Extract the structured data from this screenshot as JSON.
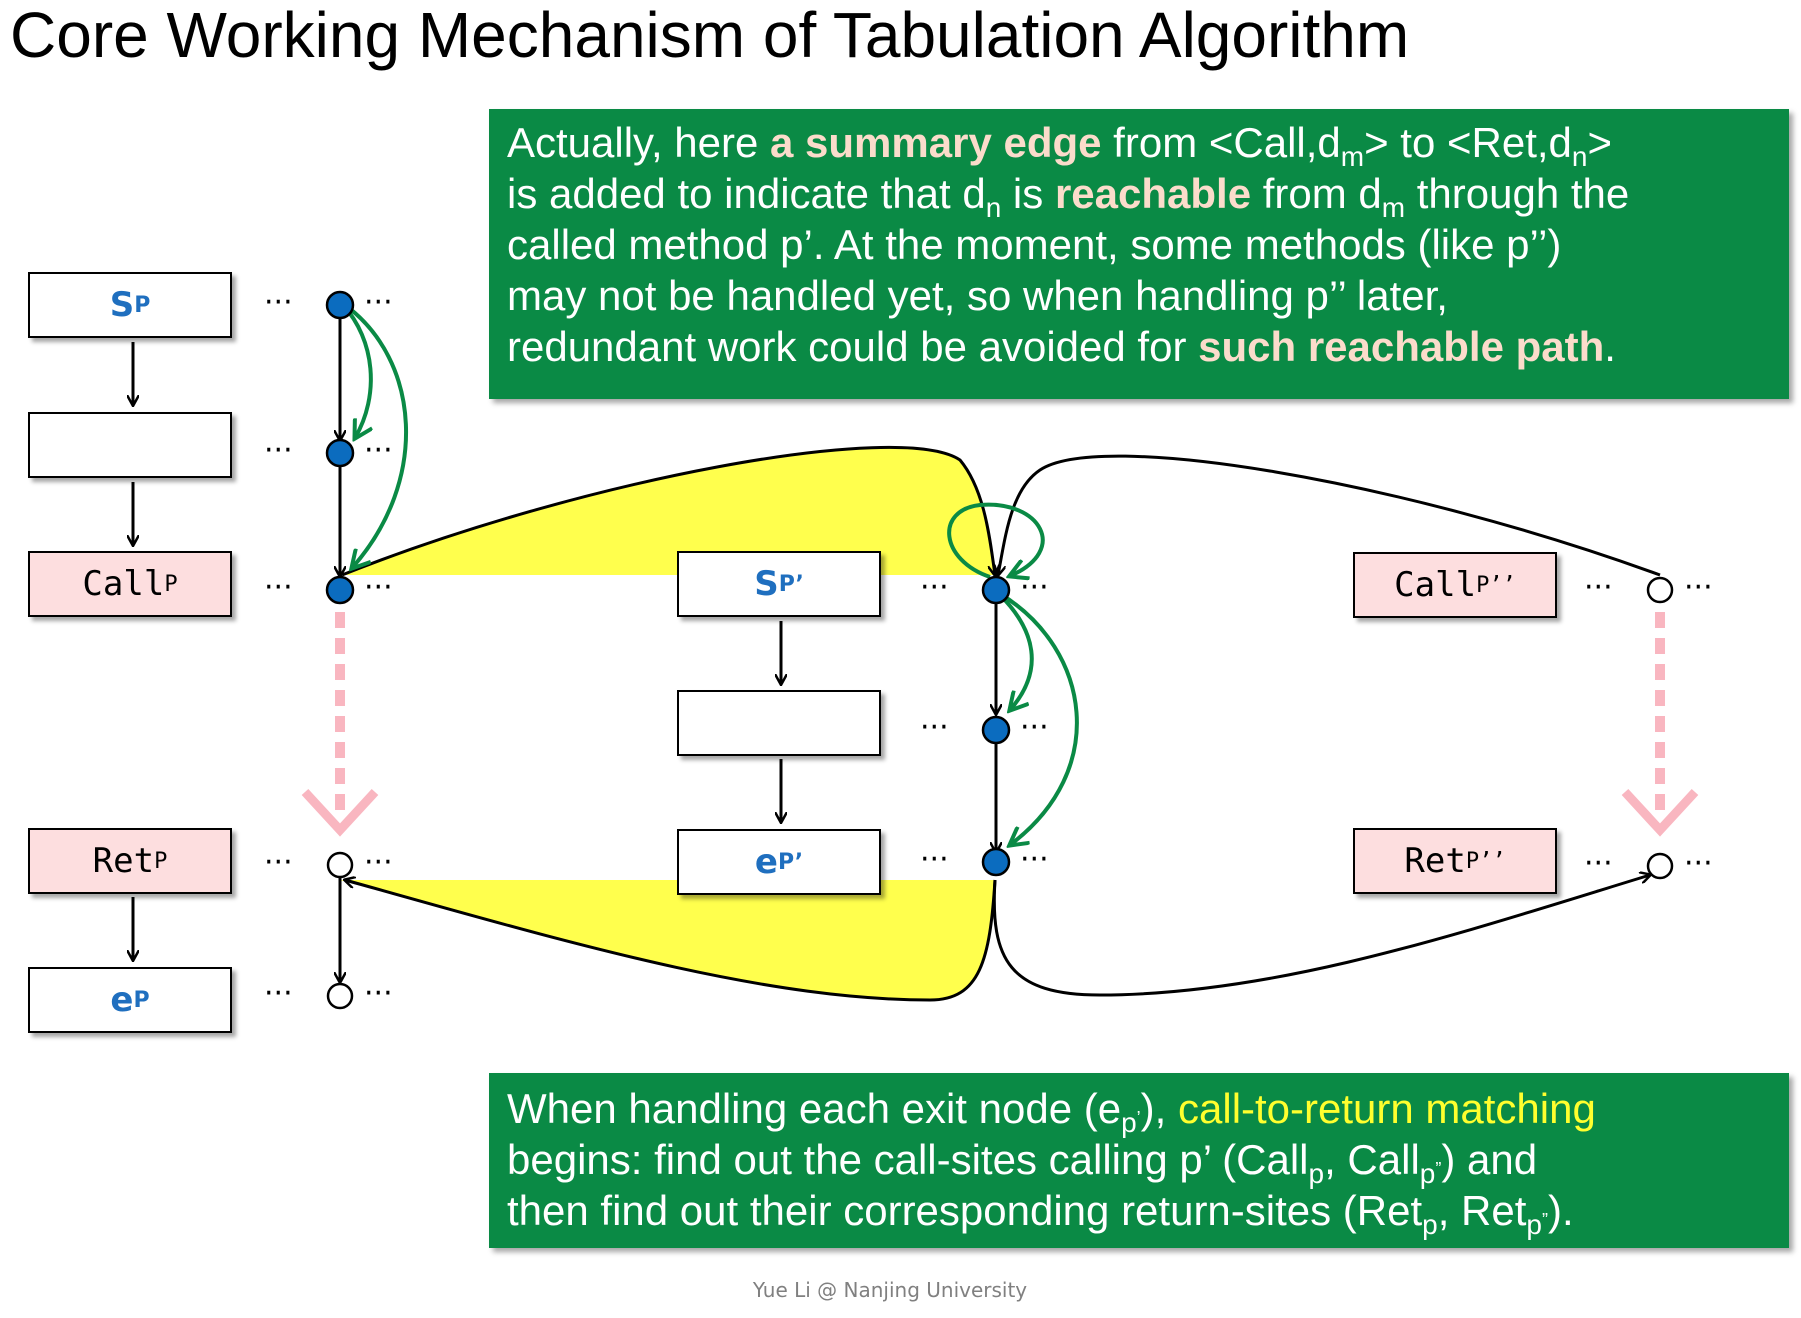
{
  "title": "Core Working Mechanism of Tabulation Algorithm",
  "footer": "Yue Li @ Nanjing University",
  "nodes": {
    "sp": {
      "main": "S",
      "sub": "P"
    },
    "call_p": {
      "main": "Call",
      "sub": "P"
    },
    "ret_p": {
      "main": "Ret",
      "sub": "P"
    },
    "ep": {
      "main": "e",
      "sub": "P"
    },
    "sp2": {
      "main": "S",
      "sub": "P’"
    },
    "ep2": {
      "main": "e",
      "sub": "P’"
    },
    "call_p2": {
      "main": "Call",
      "sub": "P’’"
    },
    "ret_p2": {
      "main": "Ret",
      "sub": "P’’"
    }
  },
  "dots": "···",
  "colors": {
    "note_bg": "#0a8a45",
    "highlight_bold": "#fbdccb",
    "highlight_yellow": "#ffff2e",
    "summary_fill": "#ffff4d",
    "green_edge": "#0a8a45",
    "node_blue": "#0b6cbf",
    "pink_box": "#fddedf",
    "pink_arrow": "#f9b6c0"
  },
  "note_top": {
    "l1a": "Actually, here ",
    "l1b": "a summary edge",
    "l1c": " from <Call,d",
    "l1d": "m",
    "l1e": "> to <Ret,d",
    "l1f": "n",
    "l1g": ">",
    "l2a": "is added to indicate that d",
    "l2b": "n",
    "l2c": " is ",
    "l2d": "reachable",
    "l2e": " from d",
    "l2f": "m",
    "l2g": " through the",
    "l3": "called method p’. At the moment, some methods (like p’’)",
    "l4": "may not be handled yet, so when handling p’’ later,",
    "l5a": "redundant work could be avoided for ",
    "l5b": "such reachable path",
    "l5c": "."
  },
  "note_bottom": {
    "l1a": "When handling each exit node (e",
    "l1b": "p",
    "l1c": "’",
    "l1d": "), ",
    "l1e": "call-to-return matching",
    "l2a": "begins: find out the call-sites calling p’ (Call",
    "l2b": "p",
    "l2c": ", Call",
    "l2d": "p",
    "l2e": "”",
    "l2f": ") and",
    "l3a": "then find out their corresponding return-sites (Ret",
    "l3b": "p",
    "l3c": ", Ret",
    "l3d": "p",
    "l3e": "”",
    "l3f": ")."
  }
}
